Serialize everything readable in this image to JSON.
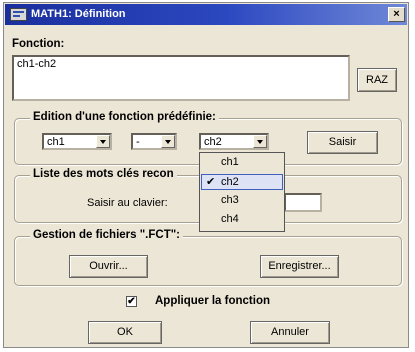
{
  "window": {
    "title": "MATH1: Définition",
    "close_label": "×"
  },
  "fonction": {
    "label": "Fonction:",
    "value": "ch1-ch2",
    "raz_label": "RAZ"
  },
  "edition": {
    "title": "Edition d'une fonction prédéfinie:",
    "combo1": "ch1",
    "combo2": "-",
    "combo3": "ch2",
    "saisir_label": "Saisir",
    "dropdown_options": [
      {
        "label": "ch1",
        "selected": false
      },
      {
        "label": "ch2",
        "selected": true
      },
      {
        "label": "ch3",
        "selected": false
      },
      {
        "label": "ch4",
        "selected": false
      }
    ],
    "check_mark": "✔"
  },
  "mots_cles": {
    "title": "Liste des mots clés recon",
    "saisir_clavier_label": "Saisir au clavier:"
  },
  "fichiers": {
    "title": "Gestion de fichiers \".FCT\":",
    "ouvrir_label": "Ouvrir...",
    "enregistrer_label": "Enregistrer..."
  },
  "appliquer": {
    "label": "Appliquer la fonction",
    "checked": true,
    "mark": "✔"
  },
  "footer": {
    "ok_label": "OK",
    "annuler_label": "Annuler"
  }
}
